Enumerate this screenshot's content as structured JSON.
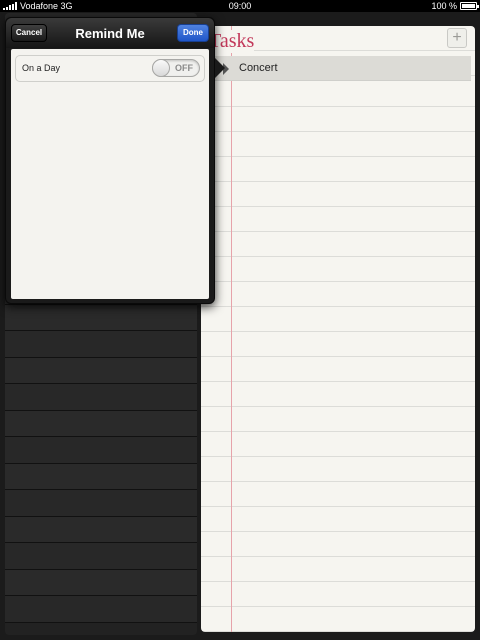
{
  "status_bar": {
    "carrier": "Vodafone 3G",
    "time": "09:00",
    "battery": "100 %",
    "battery_level": 1.0
  },
  "list_panel": {
    "title": "Tasks",
    "add_icon": "plus-icon",
    "tasks": [
      "Concert"
    ]
  },
  "popover": {
    "title": "Remind Me",
    "cancel_label": "Cancel",
    "done_label": "Done",
    "row_label": "On a Day",
    "toggle_state": "OFF"
  },
  "colors": {
    "title_red": "#c2385a",
    "done_blue": "#1f56c9"
  }
}
